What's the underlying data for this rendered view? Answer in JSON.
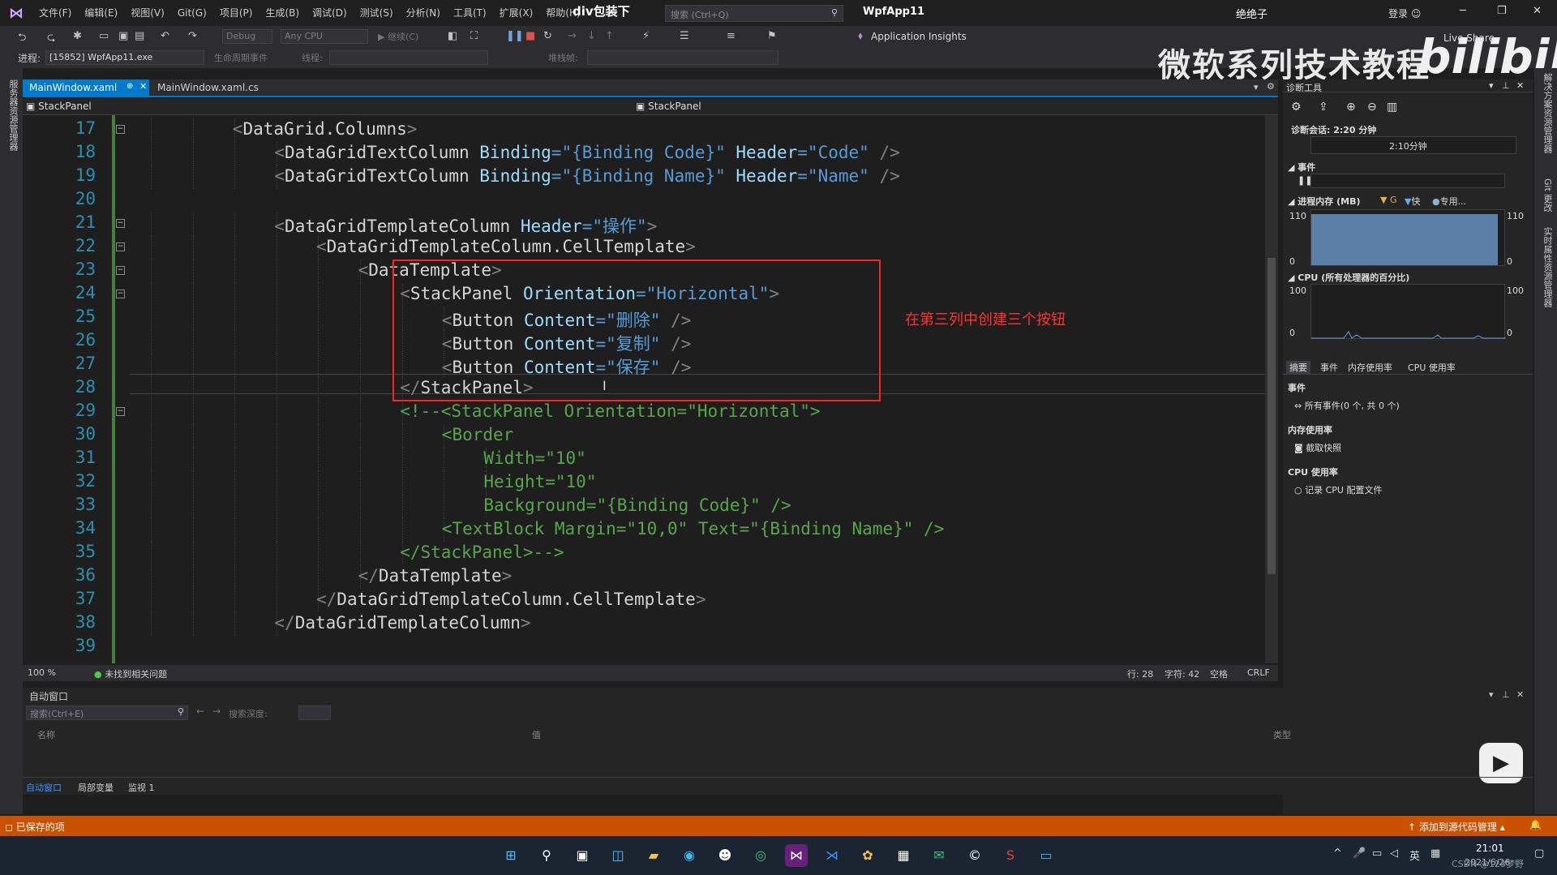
{
  "titlebar": {
    "menu": [
      "文件(F)",
      "编辑(E)",
      "视图(V)",
      "Git(G)",
      "项目(P)",
      "生成(B)",
      "调试(D)",
      "测试(S)",
      "分析(N)",
      "工具(T)",
      "扩展(X)",
      "帮助(H)"
    ],
    "overlay_title": "div包装下",
    "search_placeholder": "搜索 (Ctrl+Q)",
    "solution_name": "WpfApp11",
    "overlay_user": "绝绝子",
    "sign_in": "登录",
    "window_controls": [
      "minimize-icon",
      "restore-icon",
      "close-icon"
    ]
  },
  "toolbar": {
    "config": "Debug",
    "platform": "Any CPU",
    "continue_label": "继续(C)",
    "app_insights": "Application Insights",
    "process_label": "进程:",
    "process_value": "[15852] WpfApp11.exe",
    "lifecycle_label": "生命周期事件",
    "thread_label": "线程:",
    "stack_label": "堆栈帧:"
  },
  "watermark": {
    "text": "微软系列技术教程",
    "logo": "bilibili",
    "live_share": "Live Share"
  },
  "left_strip": {
    "label": "服务器资源管理器"
  },
  "right_strip": {
    "labels": [
      "解决方案资源管理器",
      "Git 更改",
      "实时属性资源管理器"
    ]
  },
  "tabs": [
    {
      "label": "MainWindow.xaml",
      "active": true
    },
    {
      "label": "MainWindow.xaml.cs",
      "active": false
    }
  ],
  "navbar": {
    "left": "StackPanel",
    "right": "StackPanel"
  },
  "editor": {
    "lines": [
      {
        "n": "17",
        "indent": 3,
        "code": "<DataGrid.Columns>"
      },
      {
        "n": "18",
        "indent": 4,
        "code": "<DataGridTextColumn Binding=\"{Binding Code}\" Header=\"Code\" />"
      },
      {
        "n": "19",
        "indent": 4,
        "code": "<DataGridTextColumn Binding=\"{Binding Name}\" Header=\"Name\" />"
      },
      {
        "n": "20",
        "indent": 0,
        "code": ""
      },
      {
        "n": "21",
        "indent": 4,
        "code": "<DataGridTemplateColumn Header=\"操作\">"
      },
      {
        "n": "22",
        "indent": 5,
        "code": "<DataGridTemplateColumn.CellTemplate>"
      },
      {
        "n": "23",
        "indent": 6,
        "code": "<DataTemplate>"
      },
      {
        "n": "24",
        "indent": 7,
        "code": "<StackPanel Orientation=\"Horizontal\">"
      },
      {
        "n": "25",
        "indent": 8,
        "code": "<Button Content=\"删除\" />"
      },
      {
        "n": "26",
        "indent": 8,
        "code": "<Button Content=\"复制\" />"
      },
      {
        "n": "27",
        "indent": 8,
        "code": "<Button Content=\"保存\" />"
      },
      {
        "n": "28",
        "indent": 7,
        "code": "</StackPanel>"
      },
      {
        "n": "29",
        "indent": 7,
        "code": "<!--<StackPanel Orientation=\"Horizontal\">",
        "comment": true
      },
      {
        "n": "30",
        "indent": 8,
        "code": "<Border",
        "comment": true
      },
      {
        "n": "31",
        "indent": 9,
        "code": "Width=\"10\"",
        "comment": true
      },
      {
        "n": "32",
        "indent": 9,
        "code": "Height=\"10\"",
        "comment": true
      },
      {
        "n": "33",
        "indent": 9,
        "code": "Background=\"{Binding Code}\" />",
        "comment": true
      },
      {
        "n": "34",
        "indent": 8,
        "code": "<TextBlock Margin=\"10,0\" Text=\"{Binding Name}\" />",
        "comment": true
      },
      {
        "n": "35",
        "indent": 7,
        "code": "</StackPanel>-->",
        "comment": true
      },
      {
        "n": "36",
        "indent": 6,
        "code": "</DataTemplate>"
      },
      {
        "n": "37",
        "indent": 5,
        "code": "</DataGridTemplateColumn.CellTemplate>"
      },
      {
        "n": "38",
        "indent": 4,
        "code": "</DataGridTemplateColumn>"
      },
      {
        "n": "39",
        "indent": 0,
        "code": ""
      }
    ],
    "annotation": "在第三列中创建三个按钮"
  },
  "editor_status": {
    "zoom": "100 %",
    "issues": "未找到相关问题",
    "line": "行: 28",
    "char": "字符: 42",
    "whitespace": "空格",
    "eol": "CRLF"
  },
  "diagnostics": {
    "title": "诊断工具",
    "session": "诊断会话: 2:20 分钟",
    "timeline_label": "2:10分钟",
    "events_header": "事件",
    "memory_header": "进程内存 (MB)",
    "memory_legend": [
      "G",
      "快",
      "专用..."
    ],
    "mem_max": "110",
    "mem_min": "0",
    "mem_level": 0.92,
    "cpu_header": "CPU (所有处理器的百分比)",
    "cpu_max": "100",
    "cpu_min": "0",
    "subtabs": [
      "摘要",
      "事件",
      "内存使用率",
      "CPU 使用率"
    ],
    "section_events": "事件",
    "all_events": "所有事件(0 个, 共 0 个)",
    "section_memory": "内存使用率",
    "snapshot": "截取快照",
    "section_cpu": "CPU 使用率",
    "record_cpu": "记录 CPU 配置文件"
  },
  "autowindow": {
    "title": "自动窗口",
    "search_placeholder": "搜索(Ctrl+E)",
    "search_depth": "搜索深度:",
    "columns": [
      "名称",
      "值",
      "类型"
    ],
    "tabs": [
      "自动窗口",
      "局部变量",
      "监视 1"
    ]
  },
  "statusbar": {
    "left": "已保存的项",
    "right": "添加到源代码管理"
  },
  "taskbar": {
    "time": "21:01",
    "date": "2021/6/26",
    "ime": "英",
    "watermark": "CSDN @123梦野"
  },
  "colors": {
    "accent": "#007acc",
    "status": "#ca5100",
    "redbox": "#ff2222"
  }
}
